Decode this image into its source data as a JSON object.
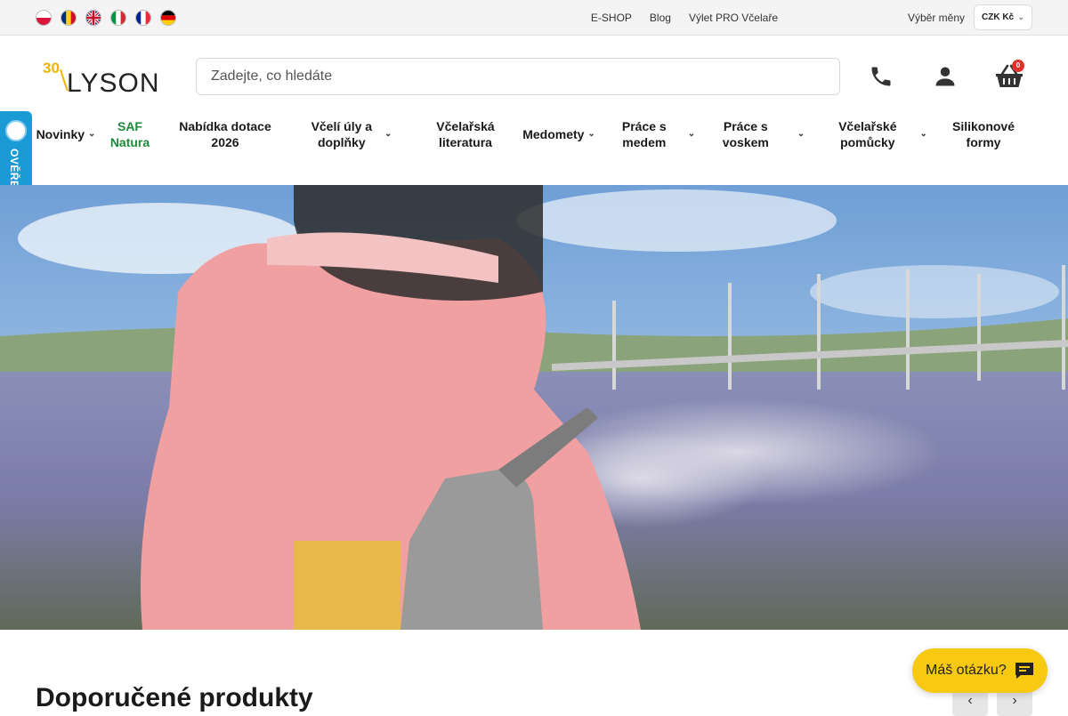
{
  "languages": [
    {
      "code": "pl",
      "icon": "flag-poland-icon"
    },
    {
      "code": "ro",
      "icon": "flag-romania-icon"
    },
    {
      "code": "en",
      "icon": "flag-uk-icon"
    },
    {
      "code": "it",
      "icon": "flag-italy-icon"
    },
    {
      "code": "fr",
      "icon": "flag-france-icon"
    },
    {
      "code": "de",
      "icon": "flag-germany-icon"
    }
  ],
  "toplinks": {
    "eshop": "E-SHOP",
    "blog": "Blog",
    "trip": "Výlet PRO Včelaře"
  },
  "currency": {
    "label": "Výběr měny",
    "selected": "CZK Kč"
  },
  "logo": {
    "number": "30",
    "name": "LYSON"
  },
  "search": {
    "placeholder": "Zadejte, co hledáte",
    "value": ""
  },
  "cart": {
    "count": "0"
  },
  "nav": [
    {
      "line1": "Novinky",
      "line2": "",
      "dropdown": true
    },
    {
      "line1": "SAF",
      "line2": "Natura",
      "dropdown": false
    },
    {
      "line1": "Nabídka dotace",
      "line2": "2026",
      "dropdown": false
    },
    {
      "line1": "Včelí úly a",
      "line2": "doplňky",
      "dropdown": true
    },
    {
      "line1": "Včelařská",
      "line2": "literatura",
      "dropdown": false
    },
    {
      "line1": "Medomety",
      "line2": "",
      "dropdown": true
    },
    {
      "line1": "Práce s",
      "line2": "medem",
      "dropdown": true
    },
    {
      "line1": "Práce s",
      "line2": "voskem",
      "dropdown": true
    },
    {
      "line1": "Včelařské",
      "line2": "pomůcky",
      "dropdown": true
    },
    {
      "line1": "Silikonové",
      "line2": "formy",
      "dropdown": false
    }
  ],
  "verified": {
    "text": "OVĚŘENO ZÁKAZNÍKY"
  },
  "section": {
    "title": "Doporučené produkty"
  },
  "carousel": {
    "prev": "‹",
    "next": "›"
  },
  "chat": {
    "label": "Máš otázku?"
  },
  "colors": {
    "accent_green": "#1e8a3a",
    "chat_yellow": "#f7c911",
    "badge_red": "#e0302a",
    "verified_blue": "#1a9bd6"
  }
}
